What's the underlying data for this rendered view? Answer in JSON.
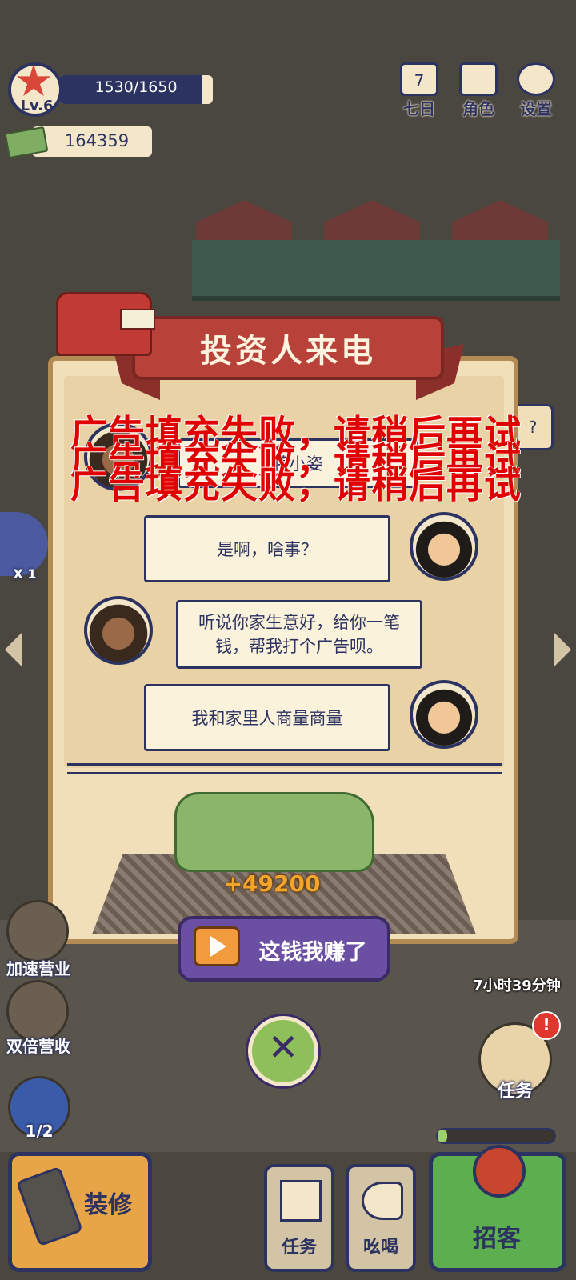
{
  "hud": {
    "level": "Lv.6",
    "xp_text": "1530/1650",
    "xp_fraction": 0.927,
    "money": "164359"
  },
  "top_buttons": [
    {
      "label": "七日",
      "icon": "calendar-icon",
      "badge": "7"
    },
    {
      "label": "角色",
      "icon": "character-card-icon"
    },
    {
      "label": "设置",
      "icon": "gear-icon"
    }
  ],
  "modal": {
    "title": "投资人来电",
    "error_overlay": [
      "广告填充失败，请稍后再试",
      "广告填充失败，请稍后再试",
      "广告填充失败，请稍后再试"
    ],
    "partial_bubble": "蒋小姿",
    "dialog": [
      {
        "side": "right",
        "text": "是啊，啥事？"
      },
      {
        "side": "left",
        "text": "听说你家生意好，给你一笔钱，帮我打个广告呗。"
      },
      {
        "side": "right",
        "text": "我和家里人商量商量"
      }
    ],
    "reward": "+49200",
    "accept_button": "这钱我赚了",
    "close_symbol": "✕"
  },
  "left_side": [
    {
      "label": "加速营业",
      "icon": "rocket-icon"
    },
    {
      "label": "双倍营收",
      "icon": "cash-stack-icon"
    },
    {
      "label": "1/2",
      "icon": "handheld-console-icon"
    }
  ],
  "right_side": {
    "timer": "7小时39分钟",
    "task_label": "任务",
    "task_badge": "!",
    "partial_question": "?",
    "crowd_label": "X 1"
  },
  "bottom_bar": {
    "renovate": "装修",
    "tasks": "任务",
    "shout": "吆喝",
    "recruit": "招客",
    "recruit_progress": 0.07
  },
  "colors": {
    "navy": "#2d3360",
    "cream": "#f4e6c9",
    "ribbon_red": "#b8423a",
    "error_red": "#e00000",
    "reward_orange": "#f3a42a",
    "button_purple": "#6b4fa3"
  }
}
